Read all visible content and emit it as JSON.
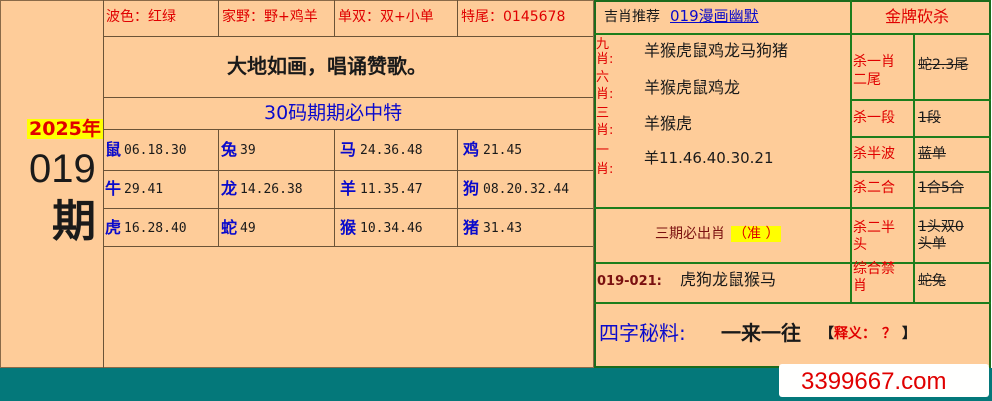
{
  "colors": {
    "panel": "#fecc99",
    "red": "#e00000",
    "blue": "#0a0acc",
    "green_border": "#1c7d1c",
    "teal_bar": "#04787a"
  },
  "issue": {
    "year": "2025年",
    "number": "019",
    "period_char": "期"
  },
  "header": {
    "wave": "波色：红绿",
    "domestic_wild": "家野：野+鸡羊",
    "odd_even": "单双：双+小单",
    "tail": "特尾：0145678"
  },
  "slogan": "大地如画，唱诵赞歌。",
  "thirty_code_title": "30码期期必中特",
  "zodiac_grid": [
    [
      {
        "animal": "鼠",
        "nums": "06.18.30"
      },
      {
        "animal": "兔",
        "nums": "39"
      },
      {
        "animal": "马",
        "nums": "24.36.48"
      },
      {
        "animal": "鸡",
        "nums": "21.45"
      }
    ],
    [
      {
        "animal": "牛",
        "nums": "29.41"
      },
      {
        "animal": "龙",
        "nums": "14.26.38"
      },
      {
        "animal": "羊",
        "nums": "11.35.47"
      },
      {
        "animal": "狗",
        "nums": "08.20.32.44"
      }
    ],
    [
      {
        "animal": "虎",
        "nums": "16.28.40"
      },
      {
        "animal": "蛇",
        "nums": "49"
      },
      {
        "animal": "猴",
        "nums": "10.34.46"
      },
      {
        "animal": "猪",
        "nums": "31.43"
      }
    ]
  ],
  "recommend": {
    "title_prefix": "吉肖推荐",
    "title_link": "019漫画幽默",
    "side_labels": [
      "九",
      "肖:",
      "六",
      "肖:",
      "三",
      "肖:",
      "一",
      "肖:"
    ],
    "lines": [
      "羊猴虎鼠鸡龙马狗猪",
      "羊猴虎鼠鸡龙",
      "羊猴虎",
      "羊11.46.40.30.21"
    ]
  },
  "gold_title": "金牌砍杀",
  "kills": [
    {
      "label": "杀一肖二尾",
      "value": "蛇2.3尾"
    },
    {
      "label": "杀一段",
      "value": "1段"
    },
    {
      "label": "杀半波",
      "value": "蓝单"
    },
    {
      "label": "杀二合",
      "value": "1合5合"
    },
    {
      "label": "杀二半头",
      "value": "1头双0头单"
    },
    {
      "label": "综合禁肖",
      "value": "蛇兔"
    }
  ],
  "three_period": {
    "text": "三期必出肖",
    "accurate": "（准 ）"
  },
  "range": {
    "label": "019-021:",
    "zodiacs": "虎狗龙鼠猴马"
  },
  "four_char": {
    "label": "四字秘料:",
    "phrase": "一来一往",
    "note_open": "【",
    "note_label": "释义：",
    "note_q": "？",
    "note_close": "】"
  },
  "brand": "3399667.com"
}
